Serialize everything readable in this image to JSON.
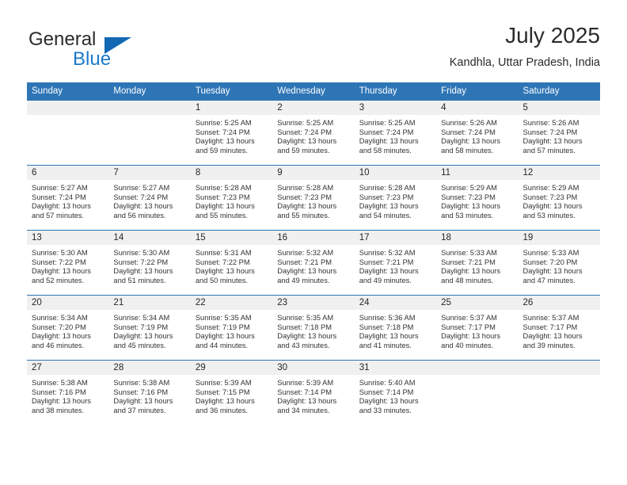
{
  "brand": {
    "name_top": "General",
    "name_bottom": "Blue",
    "accent_color": "#1268b3",
    "blue_text_color": "#1b79c9"
  },
  "header": {
    "title": "July 2025",
    "subtitle": "Kandhla, Uttar Pradesh, India"
  },
  "theme": {
    "header_blue": "#2e75b6",
    "daynum_band": "#f0f0f0",
    "text": "#333333"
  },
  "weekdays": [
    "Sunday",
    "Monday",
    "Tuesday",
    "Wednesday",
    "Thursday",
    "Friday",
    "Saturday"
  ],
  "labels": {
    "sunrise_prefix": "Sunrise:",
    "sunset_prefix": "Sunset:",
    "daylight_prefix": "Daylight:"
  },
  "weeks": [
    [
      {
        "day": "",
        "sunrise": "",
        "sunset": "",
        "daylight_line1": "",
        "daylight_line2": ""
      },
      {
        "day": "",
        "sunrise": "",
        "sunset": "",
        "daylight_line1": "",
        "daylight_line2": ""
      },
      {
        "day": "1",
        "sunrise": "Sunrise: 5:25 AM",
        "sunset": "Sunset: 7:24 PM",
        "daylight_line1": "Daylight: 13 hours",
        "daylight_line2": "and 59 minutes."
      },
      {
        "day": "2",
        "sunrise": "Sunrise: 5:25 AM",
        "sunset": "Sunset: 7:24 PM",
        "daylight_line1": "Daylight: 13 hours",
        "daylight_line2": "and 59 minutes."
      },
      {
        "day": "3",
        "sunrise": "Sunrise: 5:25 AM",
        "sunset": "Sunset: 7:24 PM",
        "daylight_line1": "Daylight: 13 hours",
        "daylight_line2": "and 58 minutes."
      },
      {
        "day": "4",
        "sunrise": "Sunrise: 5:26 AM",
        "sunset": "Sunset: 7:24 PM",
        "daylight_line1": "Daylight: 13 hours",
        "daylight_line2": "and 58 minutes."
      },
      {
        "day": "5",
        "sunrise": "Sunrise: 5:26 AM",
        "sunset": "Sunset: 7:24 PM",
        "daylight_line1": "Daylight: 13 hours",
        "daylight_line2": "and 57 minutes."
      }
    ],
    [
      {
        "day": "6",
        "sunrise": "Sunrise: 5:27 AM",
        "sunset": "Sunset: 7:24 PM",
        "daylight_line1": "Daylight: 13 hours",
        "daylight_line2": "and 57 minutes."
      },
      {
        "day": "7",
        "sunrise": "Sunrise: 5:27 AM",
        "sunset": "Sunset: 7:24 PM",
        "daylight_line1": "Daylight: 13 hours",
        "daylight_line2": "and 56 minutes."
      },
      {
        "day": "8",
        "sunrise": "Sunrise: 5:28 AM",
        "sunset": "Sunset: 7:23 PM",
        "daylight_line1": "Daylight: 13 hours",
        "daylight_line2": "and 55 minutes."
      },
      {
        "day": "9",
        "sunrise": "Sunrise: 5:28 AM",
        "sunset": "Sunset: 7:23 PM",
        "daylight_line1": "Daylight: 13 hours",
        "daylight_line2": "and 55 minutes."
      },
      {
        "day": "10",
        "sunrise": "Sunrise: 5:28 AM",
        "sunset": "Sunset: 7:23 PM",
        "daylight_line1": "Daylight: 13 hours",
        "daylight_line2": "and 54 minutes."
      },
      {
        "day": "11",
        "sunrise": "Sunrise: 5:29 AM",
        "sunset": "Sunset: 7:23 PM",
        "daylight_line1": "Daylight: 13 hours",
        "daylight_line2": "and 53 minutes."
      },
      {
        "day": "12",
        "sunrise": "Sunrise: 5:29 AM",
        "sunset": "Sunset: 7:23 PM",
        "daylight_line1": "Daylight: 13 hours",
        "daylight_line2": "and 53 minutes."
      }
    ],
    [
      {
        "day": "13",
        "sunrise": "Sunrise: 5:30 AM",
        "sunset": "Sunset: 7:22 PM",
        "daylight_line1": "Daylight: 13 hours",
        "daylight_line2": "and 52 minutes."
      },
      {
        "day": "14",
        "sunrise": "Sunrise: 5:30 AM",
        "sunset": "Sunset: 7:22 PM",
        "daylight_line1": "Daylight: 13 hours",
        "daylight_line2": "and 51 minutes."
      },
      {
        "day": "15",
        "sunrise": "Sunrise: 5:31 AM",
        "sunset": "Sunset: 7:22 PM",
        "daylight_line1": "Daylight: 13 hours",
        "daylight_line2": "and 50 minutes."
      },
      {
        "day": "16",
        "sunrise": "Sunrise: 5:32 AM",
        "sunset": "Sunset: 7:21 PM",
        "daylight_line1": "Daylight: 13 hours",
        "daylight_line2": "and 49 minutes."
      },
      {
        "day": "17",
        "sunrise": "Sunrise: 5:32 AM",
        "sunset": "Sunset: 7:21 PM",
        "daylight_line1": "Daylight: 13 hours",
        "daylight_line2": "and 49 minutes."
      },
      {
        "day": "18",
        "sunrise": "Sunrise: 5:33 AM",
        "sunset": "Sunset: 7:21 PM",
        "daylight_line1": "Daylight: 13 hours",
        "daylight_line2": "and 48 minutes."
      },
      {
        "day": "19",
        "sunrise": "Sunrise: 5:33 AM",
        "sunset": "Sunset: 7:20 PM",
        "daylight_line1": "Daylight: 13 hours",
        "daylight_line2": "and 47 minutes."
      }
    ],
    [
      {
        "day": "20",
        "sunrise": "Sunrise: 5:34 AM",
        "sunset": "Sunset: 7:20 PM",
        "daylight_line1": "Daylight: 13 hours",
        "daylight_line2": "and 46 minutes."
      },
      {
        "day": "21",
        "sunrise": "Sunrise: 5:34 AM",
        "sunset": "Sunset: 7:19 PM",
        "daylight_line1": "Daylight: 13 hours",
        "daylight_line2": "and 45 minutes."
      },
      {
        "day": "22",
        "sunrise": "Sunrise: 5:35 AM",
        "sunset": "Sunset: 7:19 PM",
        "daylight_line1": "Daylight: 13 hours",
        "daylight_line2": "and 44 minutes."
      },
      {
        "day": "23",
        "sunrise": "Sunrise: 5:35 AM",
        "sunset": "Sunset: 7:18 PM",
        "daylight_line1": "Daylight: 13 hours",
        "daylight_line2": "and 43 minutes."
      },
      {
        "day": "24",
        "sunrise": "Sunrise: 5:36 AM",
        "sunset": "Sunset: 7:18 PM",
        "daylight_line1": "Daylight: 13 hours",
        "daylight_line2": "and 41 minutes."
      },
      {
        "day": "25",
        "sunrise": "Sunrise: 5:37 AM",
        "sunset": "Sunset: 7:17 PM",
        "daylight_line1": "Daylight: 13 hours",
        "daylight_line2": "and 40 minutes."
      },
      {
        "day": "26",
        "sunrise": "Sunrise: 5:37 AM",
        "sunset": "Sunset: 7:17 PM",
        "daylight_line1": "Daylight: 13 hours",
        "daylight_line2": "and 39 minutes."
      }
    ],
    [
      {
        "day": "27",
        "sunrise": "Sunrise: 5:38 AM",
        "sunset": "Sunset: 7:16 PM",
        "daylight_line1": "Daylight: 13 hours",
        "daylight_line2": "and 38 minutes."
      },
      {
        "day": "28",
        "sunrise": "Sunrise: 5:38 AM",
        "sunset": "Sunset: 7:16 PM",
        "daylight_line1": "Daylight: 13 hours",
        "daylight_line2": "and 37 minutes."
      },
      {
        "day": "29",
        "sunrise": "Sunrise: 5:39 AM",
        "sunset": "Sunset: 7:15 PM",
        "daylight_line1": "Daylight: 13 hours",
        "daylight_line2": "and 36 minutes."
      },
      {
        "day": "30",
        "sunrise": "Sunrise: 5:39 AM",
        "sunset": "Sunset: 7:14 PM",
        "daylight_line1": "Daylight: 13 hours",
        "daylight_line2": "and 34 minutes."
      },
      {
        "day": "31",
        "sunrise": "Sunrise: 5:40 AM",
        "sunset": "Sunset: 7:14 PM",
        "daylight_line1": "Daylight: 13 hours",
        "daylight_line2": "and 33 minutes."
      },
      {
        "day": "",
        "sunrise": "",
        "sunset": "",
        "daylight_line1": "",
        "daylight_line2": ""
      },
      {
        "day": "",
        "sunrise": "",
        "sunset": "",
        "daylight_line1": "",
        "daylight_line2": ""
      }
    ]
  ]
}
